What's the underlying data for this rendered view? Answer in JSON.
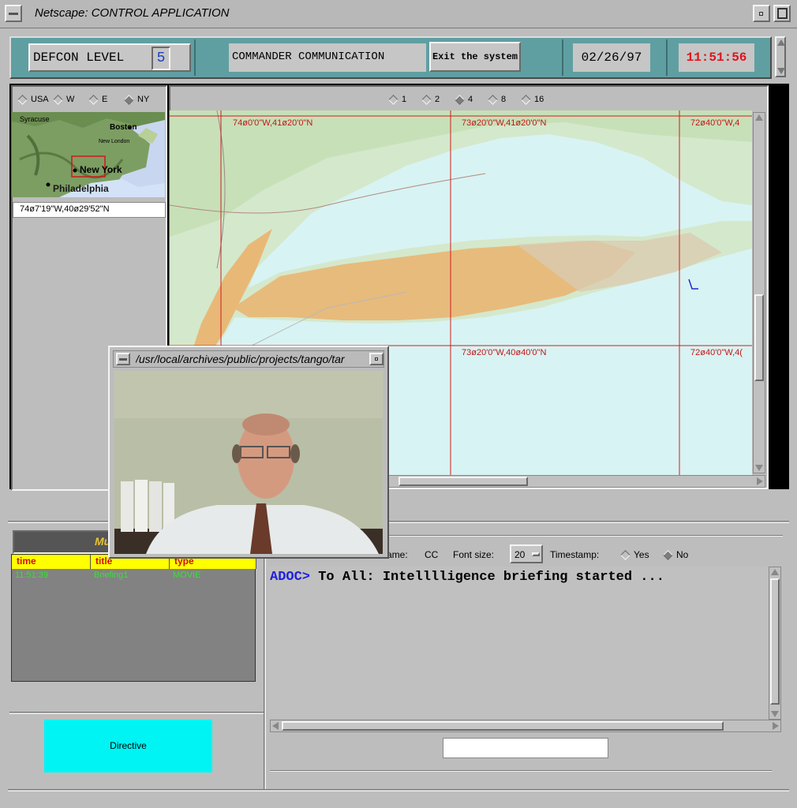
{
  "window": {
    "title": "Netscape: CONTROL APPLICATION"
  },
  "header": {
    "defcon_label": "DEFCON LEVEL",
    "defcon_value": "5",
    "comm_label": "COMMANDER COMMUNICATION",
    "exit_label": "Exit the system",
    "date": "02/26/97",
    "time": "11:51:56",
    "time_color": "#e0141c"
  },
  "region_options": [
    {
      "label": "USA",
      "selected": false
    },
    {
      "label": "W",
      "selected": false
    },
    {
      "label": "E",
      "selected": false
    },
    {
      "label": "NY",
      "selected": true
    }
  ],
  "zoom_options": [
    {
      "label": "1",
      "selected": false
    },
    {
      "label": "2",
      "selected": false
    },
    {
      "label": "4",
      "selected": true
    },
    {
      "label": "8",
      "selected": false
    },
    {
      "label": "16",
      "selected": false
    }
  ],
  "thumbnail": {
    "labels": {
      "syracuse": "Syracuse",
      "boston": "Boston",
      "new_london": "New London",
      "new_york": "New York",
      "philadelphia": "Philadelphia"
    },
    "coordinate": "74ø7'19\"W,40ø29'52\"N"
  },
  "map_grid": {
    "top_left": "74ø0'0\"W,41ø20'0\"N",
    "top_mid": "73ø20'0\"W,41ø20'0\"N",
    "top_right": "72ø40'0\"W,4",
    "mid_mid": "73ø20'0\"W,40ø40'0\"N",
    "mid_right": "72ø40'0\"W,4("
  },
  "video_window": {
    "title": "/usr/local/archives/public/projects/tango/tar"
  },
  "multimedia": {
    "title": "Mu",
    "columns": [
      "time",
      "title",
      "type"
    ],
    "rows": [
      {
        "time": "11:51:39",
        "title": "Briefing1",
        "type": "MOVIE"
      }
    ]
  },
  "directive_label": "Directive",
  "chat": {
    "name_label": "ame:",
    "name_value": "CC",
    "font_size_label": "Font size:",
    "font_size_value": "20",
    "timestamp_label": "Timestamp:",
    "yes_label": "Yes",
    "no_label": "No",
    "message_sender": "ADOC>",
    "message_text": "To All: Intelllligence briefing started ..."
  }
}
